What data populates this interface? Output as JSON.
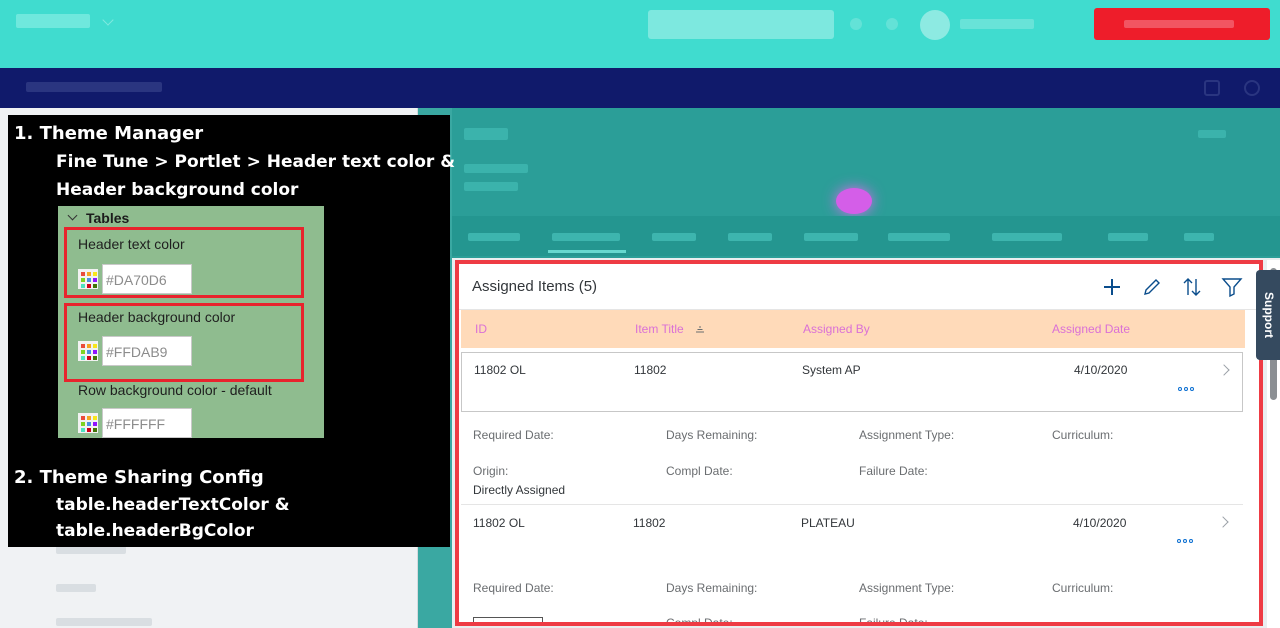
{
  "card": {
    "title": "Assigned Items (5)",
    "columns": [
      "ID",
      "Item Title",
      "Assigned By",
      "Assigned Date"
    ],
    "rows": [
      {
        "id": "11802 OL",
        "title": "11802",
        "assigned_by": "System AP",
        "date": "4/10/2020",
        "details": {
          "required_date_label": "Required Date:",
          "days_remaining_label": "Days Remaining:",
          "assignment_type_label": "Assignment Type:",
          "curriculum_label": "Curriculum:",
          "origin_label": "Origin:",
          "origin_value": "Directly Assigned",
          "compl_date_label": "Compl Date:",
          "failure_date_label": "Failure Date:"
        }
      },
      {
        "id": "11802 OL",
        "title": "11802",
        "assigned_by": "PLATEAU",
        "date": "4/10/2020",
        "details": {
          "required_date_label": "Required Date:",
          "days_remaining_label": "Days Remaining:",
          "assignment_type_label": "Assignment Type:",
          "curriculum_label": "Curriculum:",
          "compl_date_label": "Compl Date:",
          "failure_date_label": "Failure Date:"
        }
      }
    ],
    "toolbar_icons": [
      "add-icon",
      "edit-icon",
      "sort-icon",
      "filter-icon"
    ],
    "header_text_color": "#DA70D6",
    "header_bg_color": "#FFDAB9"
  },
  "support_label": "Support",
  "overlay": {
    "step1_title": "1.  Theme Manager",
    "step1_path_line1": "Fine Tune > Portlet > Header text color &",
    "step1_path_line2": "Header background color",
    "inset": {
      "section_title": "Tables",
      "fields": [
        {
          "label": "Header text color",
          "value": "#DA70D6"
        },
        {
          "label": "Header background color",
          "value": "#FFDAB9"
        },
        {
          "label": "Row background color - default",
          "value": "#FFFFFF"
        }
      ]
    },
    "step2_title": "2. Theme Sharing Config",
    "step2_line1": "table.headerTextColor &",
    "step2_line2": "table.headerBgColor"
  },
  "colors": {
    "topbar": "#40dccf",
    "navband": "#101a6b",
    "accent_blue": "#0a6ed1",
    "highlight_red": "#ee3b44",
    "inset_green": "#8fbc8f"
  }
}
